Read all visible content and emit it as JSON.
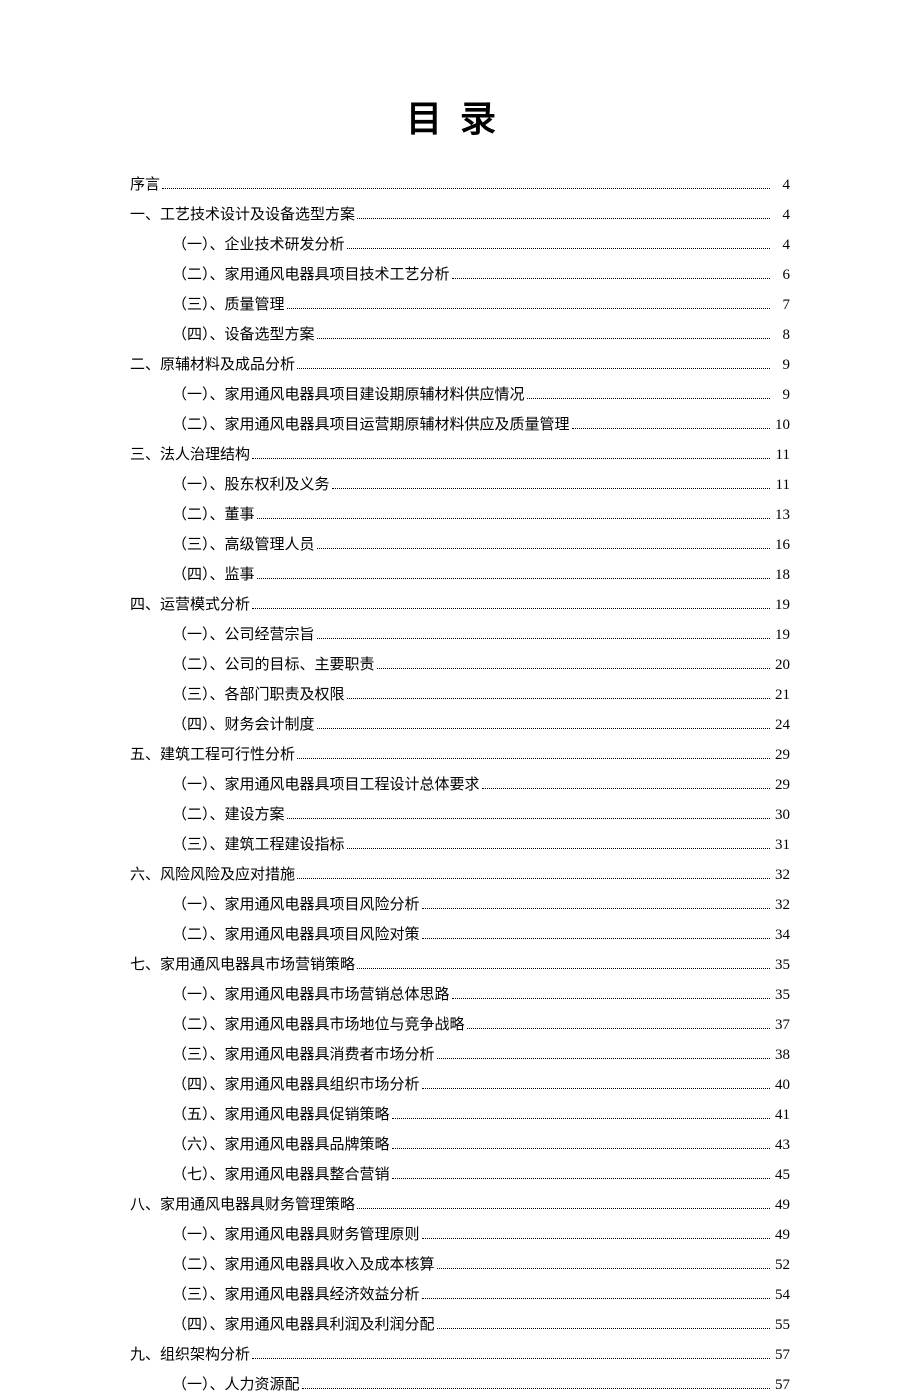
{
  "title": "目录",
  "toc": [
    {
      "level": 1,
      "label": "序言",
      "page": "4"
    },
    {
      "level": 1,
      "label": "一、工艺技术设计及设备选型方案",
      "page": "4"
    },
    {
      "level": 2,
      "label": "（一）、企业技术研发分析",
      "page": "4"
    },
    {
      "level": 2,
      "label": "（二）、家用通风电器具项目技术工艺分析",
      "page": "6"
    },
    {
      "level": 2,
      "label": "（三）、质量管理",
      "page": "7"
    },
    {
      "level": 2,
      "label": "（四）、设备选型方案",
      "page": "8"
    },
    {
      "level": 1,
      "label": "二、原辅材料及成品分析",
      "page": "9"
    },
    {
      "level": 2,
      "label": "（一）、家用通风电器具项目建设期原辅材料供应情况",
      "page": "9"
    },
    {
      "level": 2,
      "label": "（二）、家用通风电器具项目运营期原辅材料供应及质量管理",
      "page": "10"
    },
    {
      "level": 1,
      "label": "三、法人治理结构",
      "page": "11"
    },
    {
      "level": 2,
      "label": "（一）、股东权利及义务",
      "page": "11"
    },
    {
      "level": 2,
      "label": "（二）、董事",
      "page": "13"
    },
    {
      "level": 2,
      "label": "（三）、高级管理人员",
      "page": "16"
    },
    {
      "level": 2,
      "label": "（四）、监事",
      "page": "18"
    },
    {
      "level": 1,
      "label": "四、运营模式分析",
      "page": "19"
    },
    {
      "level": 2,
      "label": "（一）、公司经营宗旨",
      "page": "19"
    },
    {
      "level": 2,
      "label": "（二）、公司的目标、主要职责",
      "page": "20"
    },
    {
      "level": 2,
      "label": "（三）、各部门职责及权限",
      "page": "21"
    },
    {
      "level": 2,
      "label": "（四）、财务会计制度",
      "page": "24"
    },
    {
      "level": 1,
      "label": "五、建筑工程可行性分析",
      "page": "29"
    },
    {
      "level": 2,
      "label": "（一）、家用通风电器具项目工程设计总体要求",
      "page": "29"
    },
    {
      "level": 2,
      "label": "（二）、建设方案",
      "page": "30"
    },
    {
      "level": 2,
      "label": "（三）、建筑工程建设指标",
      "page": "31"
    },
    {
      "level": 1,
      "label": "六、风险风险及应对措施",
      "page": "32"
    },
    {
      "level": 2,
      "label": "（一）、家用通风电器具项目风险分析",
      "page": "32"
    },
    {
      "level": 2,
      "label": "（二）、家用通风电器具项目风险对策",
      "page": "34"
    },
    {
      "level": 1,
      "label": "七、家用通风电器具市场营销策略",
      "page": "35"
    },
    {
      "level": 2,
      "label": "（一）、家用通风电器具市场营销总体思路",
      "page": "35"
    },
    {
      "level": 2,
      "label": "（二）、家用通风电器具市场地位与竞争战略",
      "page": "37"
    },
    {
      "level": 2,
      "label": "（三）、家用通风电器具消费者市场分析",
      "page": "38"
    },
    {
      "level": 2,
      "label": "（四）、家用通风电器具组织市场分析",
      "page": "40"
    },
    {
      "level": 2,
      "label": "（五）、家用通风电器具促销策略",
      "page": "41"
    },
    {
      "level": 2,
      "label": "（六）、家用通风电器具品牌策略",
      "page": "43"
    },
    {
      "level": 2,
      "label": "（七）、家用通风电器具整合营销",
      "page": "45"
    },
    {
      "level": 1,
      "label": "八、家用通风电器具财务管理策略",
      "page": "49"
    },
    {
      "level": 2,
      "label": "（一）、家用通风电器具财务管理原则",
      "page": "49"
    },
    {
      "level": 2,
      "label": "（二）、家用通风电器具收入及成本核算",
      "page": "52"
    },
    {
      "level": 2,
      "label": "（三）、家用通风电器具经济效益分析",
      "page": "54"
    },
    {
      "level": 2,
      "label": "（四）、家用通风电器具利润及利润分配",
      "page": "55"
    },
    {
      "level": 1,
      "label": "九、组织架构分析",
      "page": "57"
    },
    {
      "level": 2,
      "label": "（一）、人力资源配",
      "page": "57"
    }
  ]
}
